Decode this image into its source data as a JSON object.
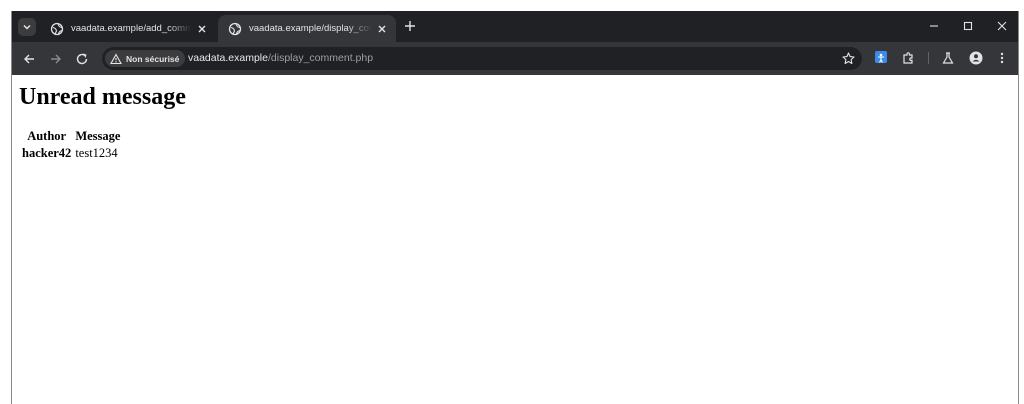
{
  "browser": {
    "tabs": [
      {
        "title": "vaadata.example/add_comment",
        "active": false
      },
      {
        "title": "vaadata.example/display_comment",
        "active": true
      }
    ],
    "security_label": "Non sécurisé",
    "url_host": "vaadata.example",
    "url_path": "/display_comment.php",
    "colors": {
      "frame": "#202124",
      "toolbar": "#35363a",
      "omnibox": "#202124"
    }
  },
  "page": {
    "heading": "Unread message",
    "table": {
      "headers": [
        "Author",
        "Message"
      ],
      "rows": [
        {
          "author": "hacker42",
          "message": "test1234"
        }
      ]
    }
  }
}
